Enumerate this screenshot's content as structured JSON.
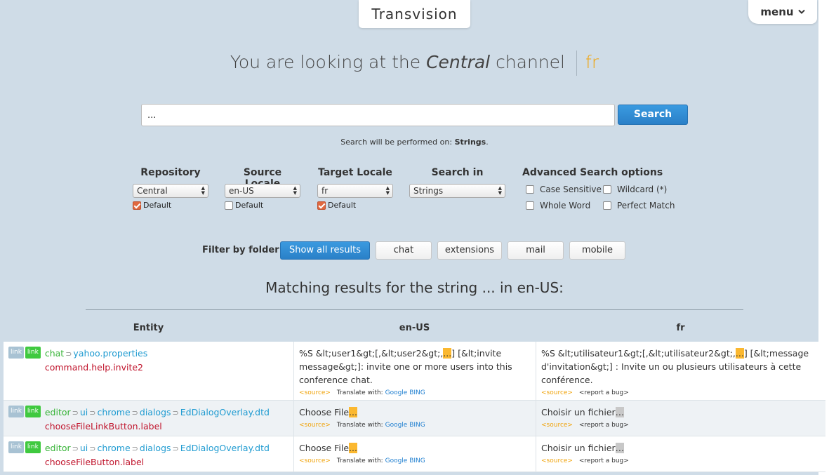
{
  "header": {
    "title": "Transvision",
    "menu_label": "menu"
  },
  "headline": {
    "prefix": "You are looking at the",
    "channel": "Central",
    "suffix": "channel",
    "locale": "fr"
  },
  "search": {
    "value": "...",
    "button_label": "Search",
    "note_prefix": "Search will be performed on:",
    "note_target": "Strings",
    "note_suffix": "."
  },
  "options": {
    "repository": {
      "label": "Repository",
      "value": "Central",
      "default_label": "Default",
      "default_checked": true
    },
    "source_locale": {
      "label": "Source Locale",
      "value": "en-US",
      "default_label": "Default",
      "default_checked": false
    },
    "target_locale": {
      "label": "Target Locale",
      "value": "fr",
      "default_label": "Default",
      "default_checked": true
    },
    "search_in": {
      "label": "Search in",
      "value": "Strings"
    },
    "advanced": {
      "title": "Advanced Search options",
      "case_sensitive": "Case Sensitive",
      "wildcard": "Wildcard (*)",
      "whole_word": "Whole Word",
      "perfect_match": "Perfect Match"
    }
  },
  "filter": {
    "label": "Filter by folder:",
    "buttons": [
      "Show all results",
      "chat",
      "extensions",
      "mail",
      "mobile"
    ]
  },
  "results": {
    "title": "Matching results for the string ... in en-US:",
    "columns": [
      "Entity",
      "en-US",
      "fr"
    ],
    "tag_link": "link",
    "source_link": "<source>",
    "translate_with": "Translate with:",
    "google": "Google",
    "bing": "BING",
    "report_bug": "<report a bug>",
    "rows": [
      {
        "path": [
          "chat",
          "yahoo.properties"
        ],
        "key": "command.help.invite2",
        "en_before": "%S &lt;user1&gt;[,&lt;user2&gt;,",
        "en_hl": "...",
        "en_after": "] [&lt;invite message&gt;]: invite one or more users into this conference chat.",
        "fr_before": "%S &lt;utilisateur1&gt;[,&lt;utilisateur2&gt;,",
        "fr_hl": "...",
        "fr_after": "] [&lt;message d'invitation&gt;] : Invite un ou plusieurs utilisateurs à cette conférence."
      },
      {
        "path": [
          "editor",
          "ui",
          "chrome",
          "dialogs",
          "EdDialogOverlay.dtd"
        ],
        "key": "chooseFileLinkButton.label",
        "en_before": "Choose File",
        "en_hl": "...",
        "en_after": "",
        "fr_before": "Choisir un fichier",
        "fr_hl": "…",
        "fr_after": ""
      },
      {
        "path": [
          "editor",
          "ui",
          "chrome",
          "dialogs",
          "EdDialogOverlay.dtd"
        ],
        "key": "chooseFileButton.label",
        "en_before": "Choose File",
        "en_hl": "...",
        "en_after": "",
        "fr_before": "Choisir un fichier",
        "fr_hl": "…",
        "fr_after": ""
      }
    ]
  }
}
